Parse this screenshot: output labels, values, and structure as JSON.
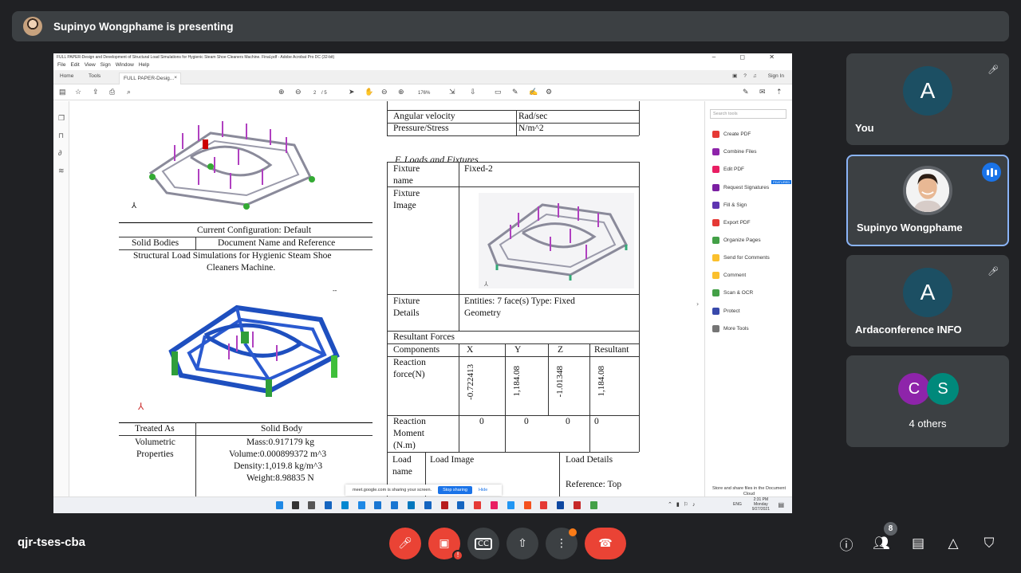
{
  "presenting": {
    "text": "Supinyo Wongphame is presenting"
  },
  "acrobat": {
    "window_title": "FULL PAPER-Design and Development of Structural Load Simulations for Hygienic Steam Shoe Cleaners Machine. Final.pdf - Adobe Acrobat Pro DC (32-bit)",
    "window_controls": "– ◻ ✕",
    "menu": [
      "File",
      "Edit",
      "View",
      "Sign",
      "Window",
      "Help"
    ],
    "tabs": {
      "home": "Home",
      "tools": "Tools",
      "active": "FULL PAPER-Desig...",
      "close": "×"
    },
    "sign_in": "Sign In",
    "page_current": "2",
    "page_total": "/ 5",
    "zoom": "176%",
    "search_placeholder": "Search tools",
    "tools_list": [
      "Create PDF",
      "Combine Files",
      "Edit PDF",
      "Request Signatures",
      "Fill & Sign",
      "Export PDF",
      "Organize Pages",
      "Send for Comments",
      "Comment",
      "Scan & OCR",
      "Protect",
      "More Tools"
    ],
    "featured_badge": "FEATURED",
    "cloud_text": "Store and share files in the Document Cloud",
    "tool_colors": [
      "#e53935",
      "#8e24aa",
      "#e91e63",
      "#7b1fa2",
      "#5e35b1",
      "#e53935",
      "#43a047",
      "#fbc02d",
      "#fbc02d",
      "#43a047",
      "#3949ab",
      "#757575"
    ]
  },
  "document": {
    "left": {
      "config_label": "Current Configuration: Default",
      "solid_bodies": "Solid Bodies",
      "doc_name_ref": "Document Name and Reference",
      "model_name_1": "Structural Load Simulations for Hygienic Steam Shoe",
      "model_name_2": "Cleaners Machine.",
      "dash": "--",
      "treated_as": "Treated As",
      "solid_body": "Solid Body",
      "volumetric_1": "Volumetric",
      "volumetric_2": "Properties",
      "mass": "Mass:0.917179 kg",
      "volume": "Volume:0.000899372 m^3",
      "density": "Density:1,019.8 kg/m^3",
      "weight": "Weight:8.98835 N"
    },
    "right": {
      "units": [
        {
          "name": "Angular velocity",
          "unit": "Rad/sec"
        },
        {
          "name": "Pressure/Stress",
          "unit": "N/m^2"
        }
      ],
      "section_heading": "F.  Loads and Fixtures",
      "fixture_name_1": "Fixture",
      "fixture_name_2": "name",
      "fixture_value": "Fixed-2",
      "fixture_image_1": "Fixture",
      "fixture_image_2": "Image",
      "fixture_details_1": "Fixture",
      "fixture_details_2": "Details",
      "entities_1": "Entities: 7 face(s) Type: Fixed",
      "entities_2": "Geometry",
      "resultant_forces": "Resultant Forces",
      "components": "Components",
      "col_x": "X",
      "col_y": "Y",
      "col_z": "Z",
      "col_resultant": "Resultant",
      "reaction_force_1": "Reaction",
      "reaction_force_2": "force(N)",
      "rf_x": "-0.722413",
      "rf_y": "1,184.08",
      "rf_z": "-1.01348",
      "rf_res": "1,184.08",
      "reaction_moment_1": "Reaction",
      "reaction_moment_2": "Moment",
      "reaction_moment_3": "(N.m)",
      "rm_x": "0",
      "rm_y": "0",
      "rm_z": "0",
      "rm_res": "0",
      "load_name_1": "Load",
      "load_name_2": "name",
      "load_image": "Load Image",
      "load_details": "Load Details",
      "reference": "Reference: Top"
    }
  },
  "sharing_bar": {
    "text": "meet.google.com is sharing your screen.",
    "stop": "Stop sharing",
    "hide": "Hide"
  },
  "taskbar": {
    "time": "2:31 PM",
    "day": "Monday",
    "date": "9/27/2021",
    "lang": "ENG",
    "icon_colors": [
      "#1e88e5",
      "#333",
      "#555",
      "#1565c0",
      "#0288d1",
      "#1e88e5",
      "#1976d2",
      "#1976d2",
      "#0277bd",
      "#1565c0",
      "#b71c1c",
      "#1565c0",
      "#e53935",
      "#e91e63",
      "#2196f3",
      "#f4511e",
      "#e53935",
      "#0d47a1",
      "#c62828",
      "#43a047"
    ]
  },
  "participants": [
    {
      "name": "You",
      "initial": "A",
      "avatar_color": "#1c4f63"
    },
    {
      "name": "Supinyo Wongphame"
    },
    {
      "name": "Ardaconference INFO",
      "initial": "A",
      "avatar_color": "#1c4f63"
    },
    {
      "name": "4 others",
      "c1": "C",
      "c2": "S",
      "c1_color": "#8e24aa",
      "c2_color": "#00897b"
    }
  ],
  "meeting": {
    "code": "qjr-tses-cba",
    "people_count": "8"
  },
  "colors": {
    "end_call": "#ea4335",
    "muted": "#ea4335",
    "accent": "#8ab4f8"
  }
}
